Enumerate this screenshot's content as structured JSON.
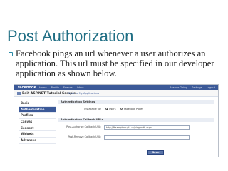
{
  "slide": {
    "title": "Post Authorization",
    "bullet": "Facebook pings an url whenever a user authorizes an application. This url must be specified in our developer application as shown below."
  },
  "screenshot": {
    "topbar": {
      "logo": "facebook",
      "nav": [
        "Home",
        "Profile",
        "Friends",
        "Inbox"
      ],
      "right": [
        "Answer Going",
        "Settings",
        "Logout"
      ]
    },
    "app": {
      "title": "Edit ASP.NET Tutorial Sample",
      "back_link": "Back to My Applications"
    },
    "sidebar": [
      "Basic",
      "Authentication",
      "Profiles",
      "Canvas",
      "Connect",
      "Widgets",
      "Advanced"
    ],
    "active_sidebar_index": 1,
    "auth_settings": {
      "heading": "Authentication Settings",
      "installable_label": "Installable to?",
      "option_users": "Users",
      "option_pages": "Facebook Pages"
    },
    "callback_urls": {
      "heading": "Authentication Callback URLs",
      "post_auth_label": "Post-Authorize Callback URL:",
      "post_auth_value": "http://fbsamples.r.gt1.ru/ping/auth.aspx",
      "post_remove_label": "Post-Remove Callback URL:",
      "post_remove_value": ""
    },
    "save_label": "Save Changes"
  }
}
